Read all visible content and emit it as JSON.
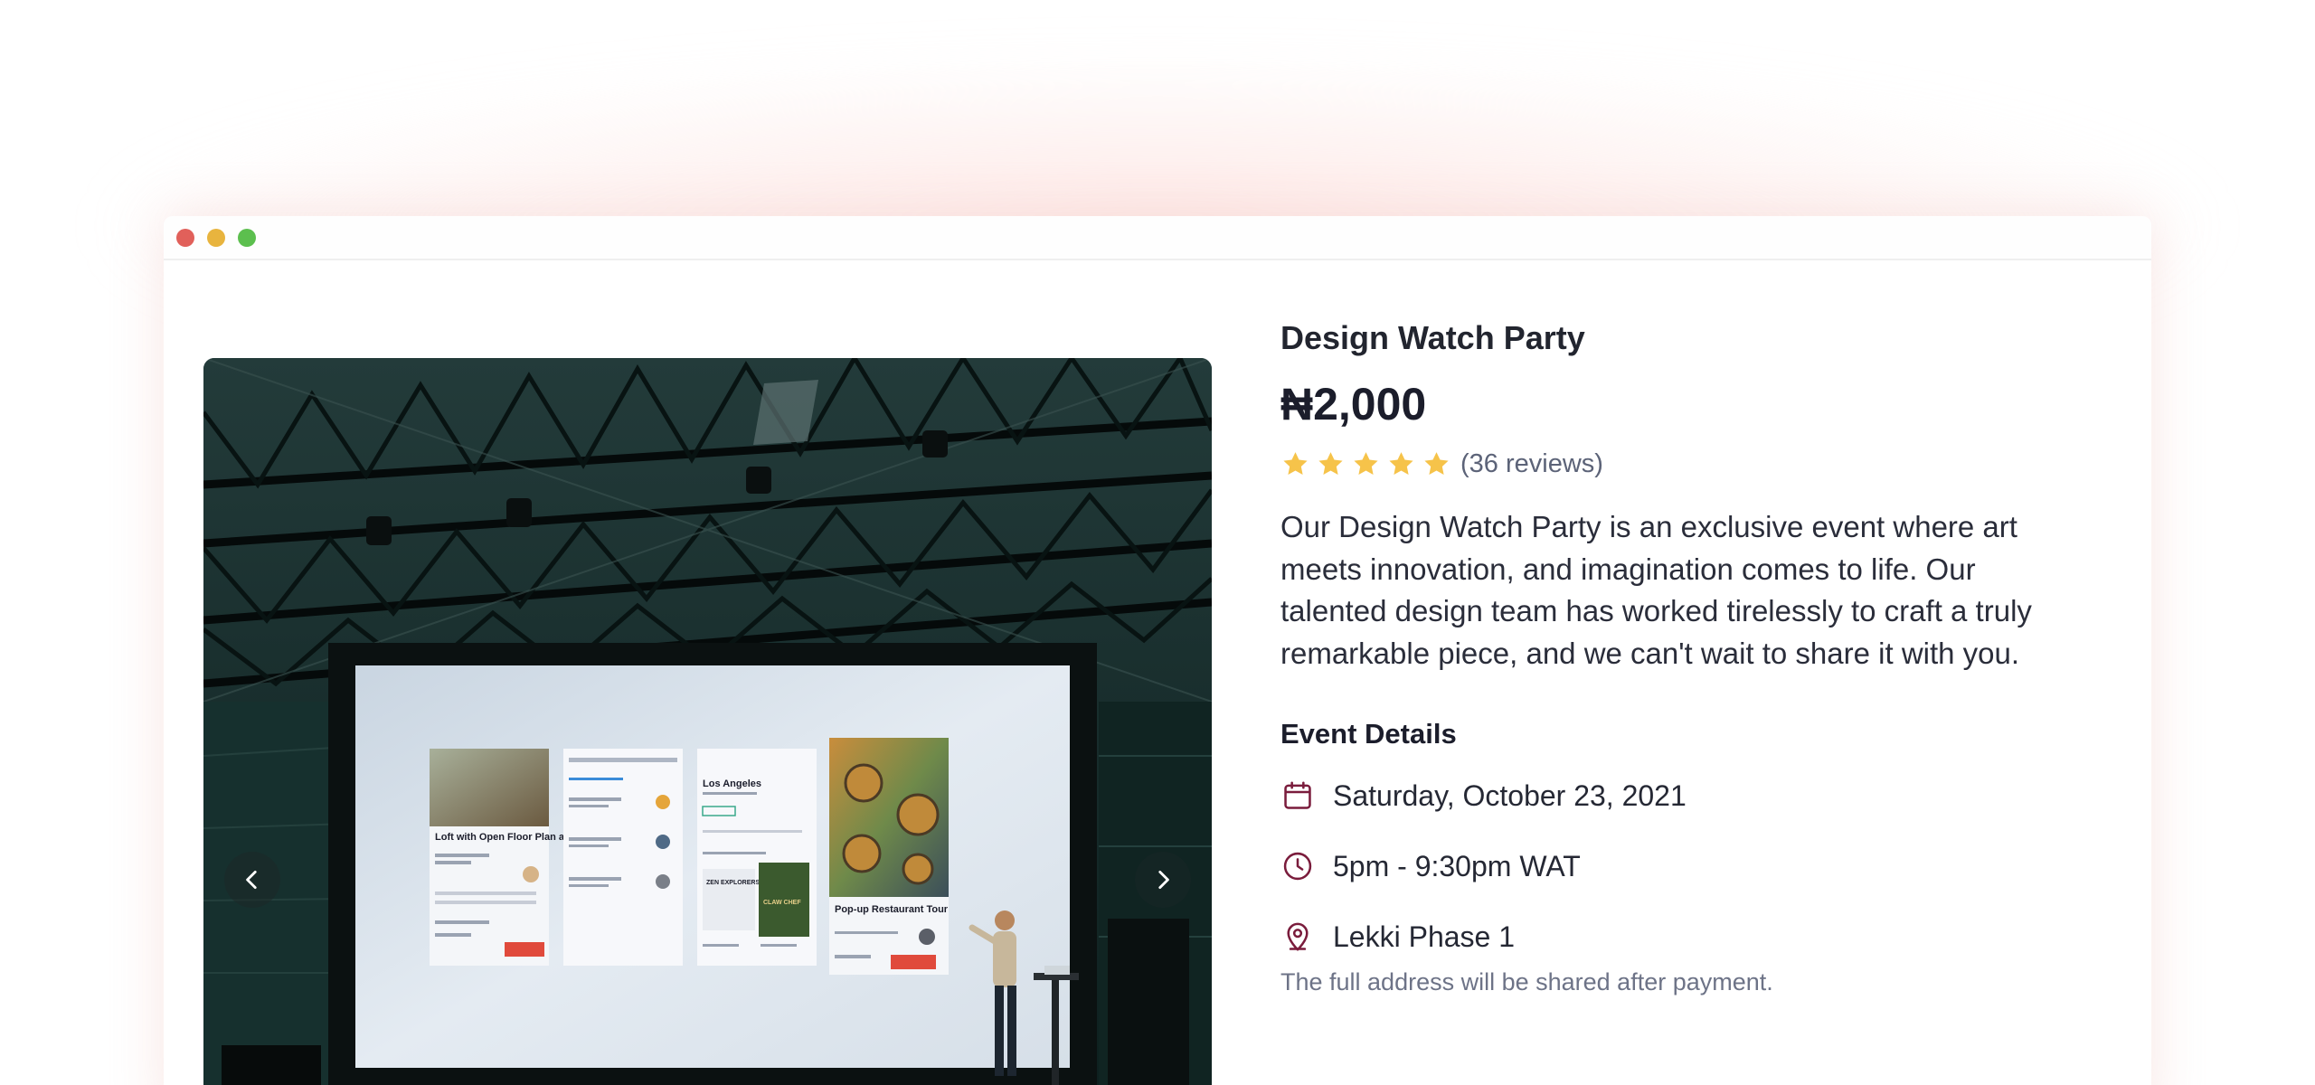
{
  "window": {
    "controls": {
      "close_color": "#e1605a",
      "minimize_color": "#e8b43e",
      "maximize_color": "#5cbf4e"
    }
  },
  "carousel": {
    "prev_icon": "chevron-left-icon",
    "next_icon": "chevron-right-icon",
    "screen_cards": {
      "card1_title": "Loft with Open Floor Plan and Kitchen",
      "card3_title": "Los Angeles",
      "card3_book_title": "ZEN EXPLORERS",
      "card3_book2_title": "CLAW CHEF",
      "card4_title": "Pop-up Restaurant Tour"
    }
  },
  "event": {
    "title": "Design Watch Party",
    "price": "₦2,000",
    "rating": 5,
    "reviews": "(36 reviews)",
    "star_color": "#f6c34a",
    "description": "Our Design Watch Party is an exclusive event where art meets innovation, and imagination comes to life. Our talented design team has worked tirelessly to craft a truly remarkable piece, and we can't wait to share it with you."
  },
  "details": {
    "heading": "Event Details",
    "date": "Saturday, October 23, 2021",
    "time": "5pm - 9:30pm WAT",
    "location": "Lekki Phase 1",
    "note": "The full address will be shared after payment.",
    "icon_color": "#7a1c3c"
  }
}
